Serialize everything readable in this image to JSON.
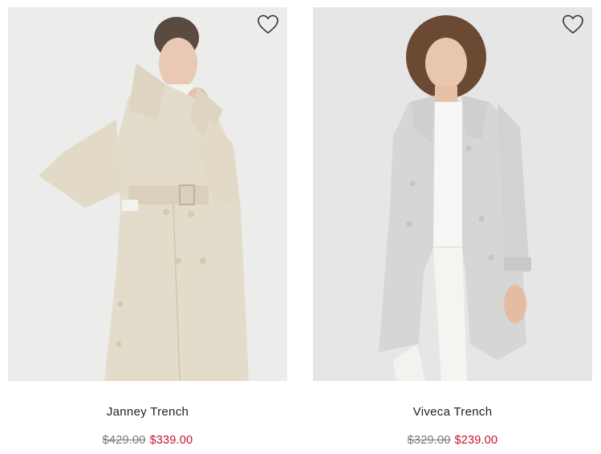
{
  "products": [
    {
      "name": "Janney Trench",
      "price_original": "$429.00",
      "price_sale": "$339.00",
      "image_icon": "trench-coat-beige-photo",
      "wishlist_icon": "heart-outline-icon"
    },
    {
      "name": "Viveca Trench",
      "price_original": "$329.00",
      "price_sale": "$239.00",
      "image_icon": "trench-coat-grey-photo",
      "wishlist_icon": "heart-outline-icon"
    }
  ],
  "colors": {
    "sale_price": "#c8102e",
    "original_price": "#7a7a7a",
    "beige_coat": "#e4dccb",
    "grey_coat": "#d6d6d6"
  }
}
